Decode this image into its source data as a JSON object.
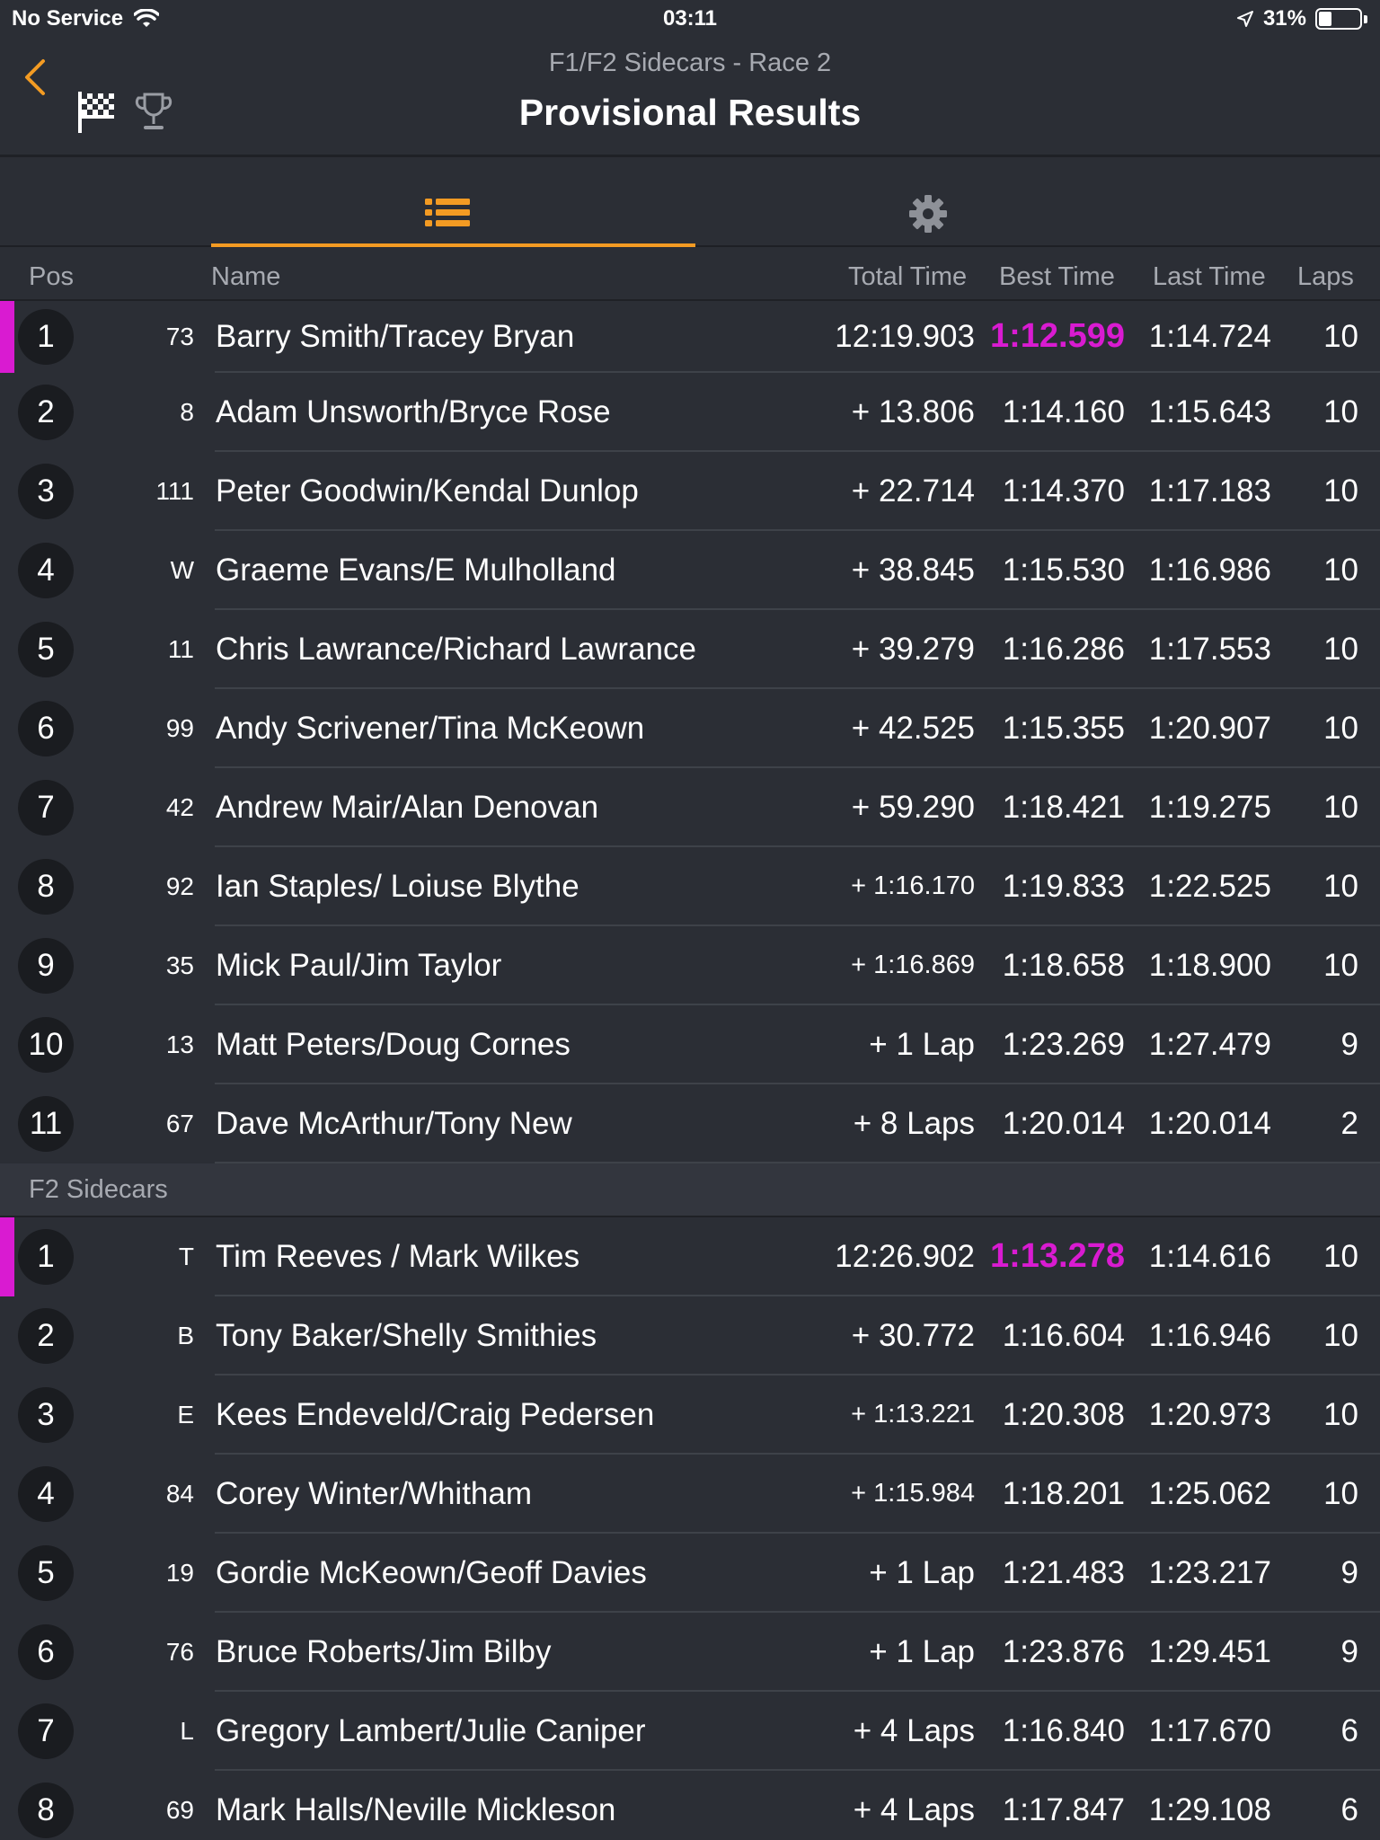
{
  "status_bar": {
    "carrier": "No Service",
    "time": "03:11",
    "battery_percent": "31%",
    "battery_level": 0.31
  },
  "header": {
    "subtitle": "F1/F2 Sidecars - Race 2",
    "title": "Provisional Results"
  },
  "columns": {
    "pos": "Pos",
    "name": "Name",
    "total": "Total Time",
    "best": "Best Time",
    "last": "Last Time",
    "laps": "Laps"
  },
  "section_f1": {
    "rows": [
      {
        "pos": "1",
        "num": "73",
        "name": "Barry Smith/Tracey Bryan",
        "total": "12:19.903",
        "best": "1:12.599",
        "last": "1:14.724",
        "laps": "10",
        "fastest": true
      },
      {
        "pos": "2",
        "num": "8",
        "name": "Adam Unsworth/Bryce Rose",
        "total": "+ 13.806",
        "best": "1:14.160",
        "last": "1:15.643",
        "laps": "10"
      },
      {
        "pos": "3",
        "num": "111",
        "name": "Peter Goodwin/Kendal Dunlop",
        "total": "+ 22.714",
        "best": "1:14.370",
        "last": "1:17.183",
        "laps": "10"
      },
      {
        "pos": "4",
        "num": "W",
        "name": "Graeme Evans/E Mulholland",
        "total": "+ 38.845",
        "best": "1:15.530",
        "last": "1:16.986",
        "laps": "10"
      },
      {
        "pos": "5",
        "num": "11",
        "name": "Chris Lawrance/Richard Lawrance",
        "total": "+ 39.279",
        "best": "1:16.286",
        "last": "1:17.553",
        "laps": "10"
      },
      {
        "pos": "6",
        "num": "99",
        "name": "Andy Scrivener/Tina McKeown",
        "total": "+ 42.525",
        "best": "1:15.355",
        "last": "1:20.907",
        "laps": "10"
      },
      {
        "pos": "7",
        "num": "42",
        "name": "Andrew Mair/Alan Denovan",
        "total": "+ 59.290",
        "best": "1:18.421",
        "last": "1:19.275",
        "laps": "10"
      },
      {
        "pos": "8",
        "num": "92",
        "name": "Ian Staples/ Loiuse Blythe",
        "total": "+ 1:16.170",
        "best": "1:19.833",
        "last": "1:22.525",
        "laps": "10",
        "small_total": true
      },
      {
        "pos": "9",
        "num": "35",
        "name": "Mick Paul/Jim Taylor",
        "total": "+ 1:16.869",
        "best": "1:18.658",
        "last": "1:18.900",
        "laps": "10",
        "small_total": true
      },
      {
        "pos": "10",
        "num": "13",
        "name": "Matt Peters/Doug Cornes",
        "total": "+ 1 Lap",
        "best": "1:23.269",
        "last": "1:27.479",
        "laps": "9"
      },
      {
        "pos": "11",
        "num": "67",
        "name": "Dave McArthur/Tony New",
        "total": "+ 8 Laps",
        "best": "1:20.014",
        "last": "1:20.014",
        "laps": "2"
      }
    ]
  },
  "section_f2": {
    "title": "F2 Sidecars",
    "rows": [
      {
        "pos": "1",
        "num": "T",
        "name": "Tim Reeves / Mark Wilkes",
        "total": "12:26.902",
        "best": "1:13.278",
        "last": "1:14.616",
        "laps": "10",
        "fastest": true
      },
      {
        "pos": "2",
        "num": "B",
        "name": "Tony Baker/Shelly Smithies",
        "total": "+ 30.772",
        "best": "1:16.604",
        "last": "1:16.946",
        "laps": "10"
      },
      {
        "pos": "3",
        "num": "E",
        "name": "Kees Endeveld/Craig Pedersen",
        "total": "+ 1:13.221",
        "best": "1:20.308",
        "last": "1:20.973",
        "laps": "10",
        "small_total": true
      },
      {
        "pos": "4",
        "num": "84",
        "name": "Corey Winter/Whitham",
        "total": "+ 1:15.984",
        "best": "1:18.201",
        "last": "1:25.062",
        "laps": "10",
        "small_total": true
      },
      {
        "pos": "5",
        "num": "19",
        "name": "Gordie McKeown/Geoff Davies",
        "total": "+ 1 Lap",
        "best": "1:21.483",
        "last": "1:23.217",
        "laps": "9"
      },
      {
        "pos": "6",
        "num": "76",
        "name": "Bruce Roberts/Jim Bilby",
        "total": "+ 1 Lap",
        "best": "1:23.876",
        "last": "1:29.451",
        "laps": "9"
      },
      {
        "pos": "7",
        "num": "L",
        "name": "Gregory Lambert/Julie Caniper",
        "total": "+ 4 Laps",
        "best": "1:16.840",
        "last": "1:17.670",
        "laps": "6"
      },
      {
        "pos": "8",
        "num": "69",
        "name": "Mark Halls/Neville Mickleson",
        "total": "+ 4 Laps",
        "best": "1:17.847",
        "last": "1:29.108",
        "laps": "6"
      }
    ]
  },
  "colors": {
    "accent": "#f39b23",
    "fastest": "#d91bd1",
    "background": "#2b2e35"
  }
}
